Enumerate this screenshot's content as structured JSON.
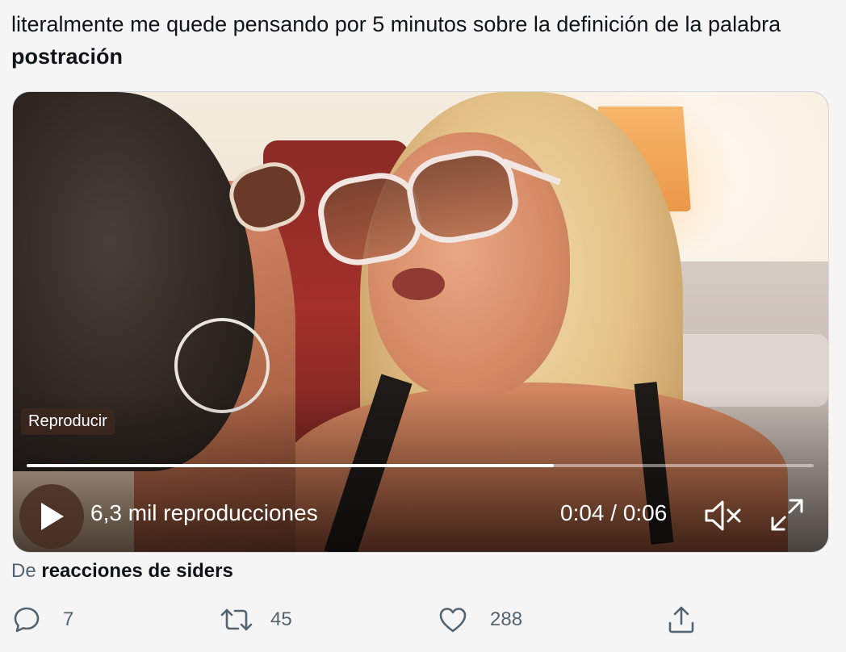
{
  "tweet": {
    "text_prefix": "literalmente me quede pensando por 5 minutos sobre la definición de la palabra ",
    "text_bold": "postración"
  },
  "video": {
    "play_label": "Reproducir",
    "views": "6,3 mil reproducciones",
    "time": "0:04 / 0:06",
    "progress_fraction": 0.67,
    "icons": {
      "play": "play-icon",
      "mute": "speaker-muted-icon",
      "fullscreen": "expand-icon"
    }
  },
  "source": {
    "prefix": "De",
    "name": "reacciones de siders"
  },
  "actions": {
    "reply": {
      "icon": "reply-icon",
      "count": "7"
    },
    "retweet": {
      "icon": "retweet-icon",
      "count": "45"
    },
    "like": {
      "icon": "heart-icon",
      "count": "288"
    },
    "share": {
      "icon": "share-icon"
    }
  },
  "colors": {
    "text": "#0f1419",
    "muted": "#536471",
    "background": "#f5f5f6"
  }
}
